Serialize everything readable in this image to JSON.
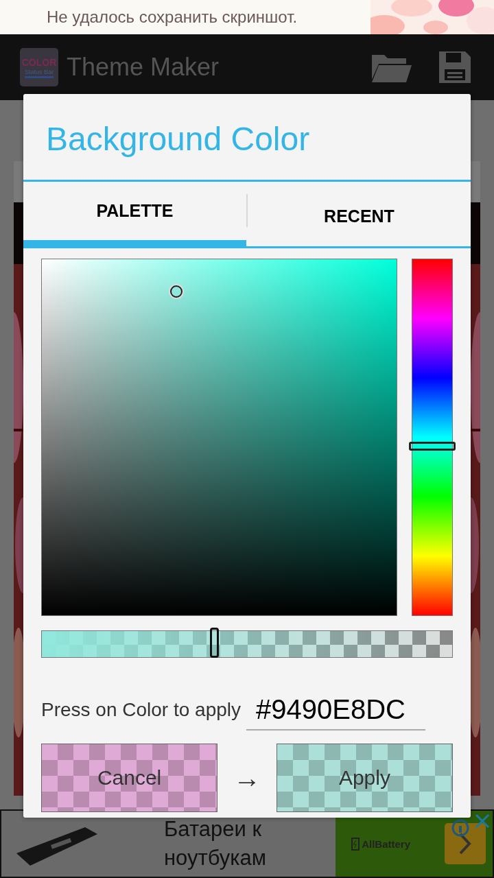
{
  "notification": {
    "text": "Не удалось сохранить скриншот."
  },
  "app_bar": {
    "icon_texts": [
      "COLOR",
      "Status Bar"
    ],
    "title": "Theme Maker"
  },
  "dialog": {
    "title": "Background Color",
    "tabs": [
      {
        "label": "PALETTE",
        "selected": true
      },
      {
        "label": "RECENT",
        "selected": false
      }
    ],
    "hue_slider": {
      "level": 0.524
    },
    "alpha_slider": {
      "level": 0.42
    },
    "hint": "Press on Color to apply",
    "hex_field": {
      "value": "#9490E8DC"
    },
    "buttons": [
      {
        "label": "Cancel",
        "color": "#e0aad6"
      },
      {
        "label": "Apply",
        "color": "#acdfd8"
      }
    ],
    "arrow": "→"
  },
  "ad": {
    "headline": "Батареи к ноутбукам",
    "brand": "AllBattery"
  }
}
